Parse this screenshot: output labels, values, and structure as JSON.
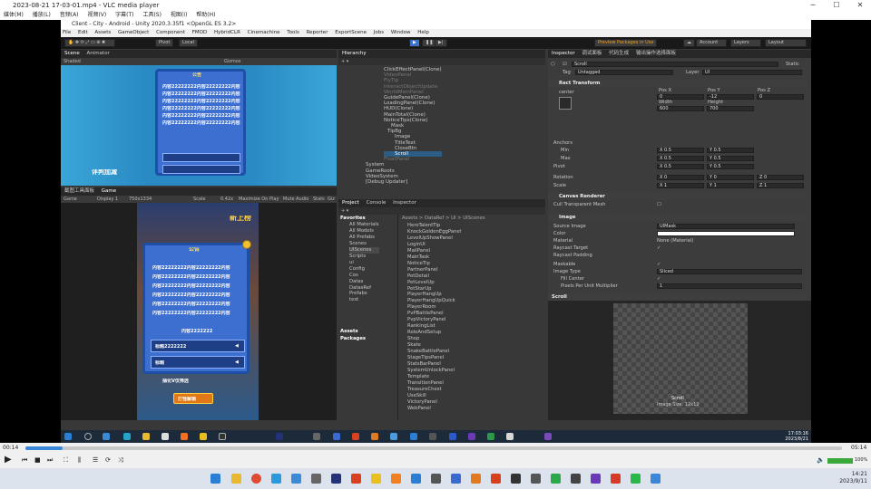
{
  "vlc": {
    "title": "2023-08-21 17-03-01.mp4 - VLC media player",
    "menu": [
      "媒体(M)",
      "播放(L)",
      "音频(A)",
      "视频(V)",
      "字幕(T)",
      "工具(S)",
      "视图(I)",
      "帮助(H)"
    ],
    "time_elapsed": "00:14",
    "time_total": "05:14",
    "volume": "100%",
    "progress": 0.045
  },
  "unity": {
    "title": "Client - City - Android - Unity 2020.3.35f1 <OpenGL ES 3.2>",
    "menu": [
      "File",
      "Edit",
      "Assets",
      "GameObject",
      "Component",
      "FMOD",
      "HybridCLR",
      "Cinemachine",
      "Tools",
      "Reporter",
      "ExportScene",
      "Jobs",
      "Window",
      "Help"
    ],
    "toolbar": {
      "pivot": "Pivot",
      "local": "Local",
      "preview_packages": "Preview Packages in Use",
      "account": "Account",
      "layers": "Layers",
      "layout": "Layout"
    },
    "scene": {
      "tabs": [
        "Scene",
        "Animator"
      ],
      "shading": "Shaded",
      "gizmos": "Gizmos",
      "label": "评判加减"
    },
    "game": {
      "tabs": [
        "截图工具面板",
        "Game"
      ],
      "display": "Game",
      "display_num": "Display 1",
      "resolution": "750x1334",
      "scale": "Scale",
      "scale_value": "0.42x",
      "options": [
        "Maximize On Play",
        "Mute Audio",
        "Stats",
        "Giz"
      ],
      "notice_title": "公告",
      "rank_title": "新上榜",
      "body_line": "内容22222222内容22222222内容",
      "footer_text": "内容2222222",
      "bar_text": "标题2222222",
      "bar2_text": "标题",
      "bottom_label": "抽化V仅筛选",
      "bottom_btn": "打怪解锁"
    },
    "hierarchy": {
      "tab": "Hierarchy",
      "items": [
        "ClickEffectPanel(Clone)",
        "VideoPanel",
        "FlyTip",
        "InteractObjectUpdate",
        "WorldMainPanel",
        "GuidePanel(Clone)",
        "LoadingPanel(Clone)",
        "HUD(Clone)",
        "MainTotal(Clone)",
        "NoticeTips(Clone)",
        "Mask",
        "TipBg",
        "Image",
        "TitleText",
        "CloseBtn",
        "Scroll",
        "FloatPanel",
        "System",
        "GameRoots",
        "VideoSystem",
        "[Debug Updater]"
      ]
    },
    "project": {
      "tabs": [
        "Project",
        "Console",
        "Inspector"
      ],
      "breadcrumb": "Assets > DataRef > UI > UIScenes",
      "favorites": "Favorites",
      "fav_items": [
        "All Materials",
        "All Models",
        "All Prefabs",
        "Scenes",
        "UIScenes",
        "Scripts",
        "ui",
        "Config",
        "Cos",
        "Datas",
        "DatasRef",
        "Prefabs",
        "test"
      ],
      "assets": "Assets",
      "packages": "Packages",
      "files": [
        "HeroTalentTip",
        "KnockGoldenEggPanel",
        "LevelUpShowPanel",
        "LoginUI",
        "MailPanel",
        "MainTask",
        "NoticeTip",
        "PartnerPanel",
        "PetDetail",
        "PetLevelUp",
        "PetStarUp",
        "PlayerHangUp",
        "PlayerHangUpQuick",
        "PlayerRoom",
        "PvPBattlePanel",
        "PvpVictoryPanel",
        "RankingList",
        "RoleAndSetup",
        "Shop",
        "Skate",
        "SnakeBattlePanel",
        "StageTipsPanel",
        "StatsBarPanel",
        "SystemUnlockPanel",
        "Template",
        "TransitionPanel",
        "TreasureChest",
        "UseSkill",
        "VictoryPanel",
        "WebPanel"
      ]
    },
    "inspector": {
      "tabs": [
        "Inspector",
        "调试面板",
        "代码生成",
        "输出操作选择面板"
      ],
      "object_name": "Scroll",
      "static": "Static",
      "tag_label": "Tag",
      "tag": "Untagged",
      "layer_label": "Layer",
      "layer": "UI",
      "rect_transform": "Rect Transform",
      "anchor_preset": "center",
      "pos_labels": [
        "Pos X",
        "Pos Y",
        "Pos Z"
      ],
      "pos_values": [
        "0",
        "-12",
        "0"
      ],
      "size_labels": [
        "Width",
        "Height"
      ],
      "size_values": [
        "600",
        "700"
      ],
      "anchors": "Anchors",
      "min_label": "Min",
      "min": [
        "X 0.5",
        "Y 0.5"
      ],
      "max_label": "Max",
      "max": [
        "X 0.5",
        "Y 0.5"
      ],
      "pivot_label": "Pivot",
      "pivot": [
        "X 0.5",
        "Y 0.5"
      ],
      "rotation_label": "Rotation",
      "rotation": [
        "X 0",
        "Y 0",
        "Z 0"
      ],
      "scale_label": "Scale",
      "scale": [
        "X 1",
        "Y 1",
        "Z 1"
      ],
      "canvas_renderer": "Canvas Renderer",
      "cull_mesh": "Cull Transparent Mesh",
      "image": "Image",
      "props": [
        [
          "Source Image",
          "UIMask"
        ],
        [
          "Color",
          ""
        ],
        [
          "Material",
          "None (Material)"
        ],
        [
          "Raycast Target",
          "✓"
        ],
        [
          "Raycast Padding",
          ""
        ],
        [
          "Maskable",
          "✓"
        ],
        [
          "Image Type",
          "Sliced"
        ],
        [
          "Fill Center",
          "✓"
        ],
        [
          "Pixels Per Unit Multiplier",
          "1"
        ]
      ],
      "preview_header": "Scroll",
      "preview_name": "Scroll",
      "preview_size": "Image Size: 12x12"
    },
    "clock": {
      "time": "17:03:16",
      "date": "2023/8/21"
    }
  },
  "windows": {
    "time": "14:21",
    "date": "2023/9/11"
  }
}
